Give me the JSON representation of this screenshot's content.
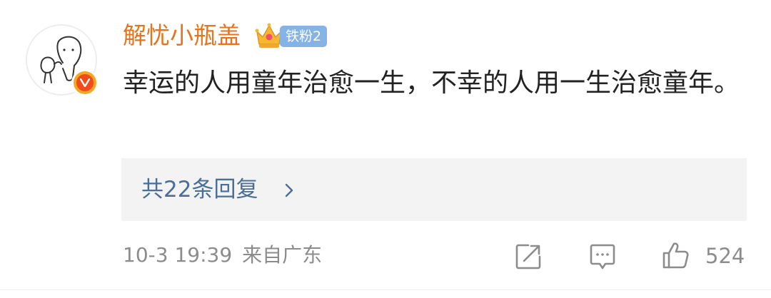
{
  "comment": {
    "username": "解忧小瓶盖",
    "fan_badge": "铁粉2",
    "text": "幸运的人用童年治愈一生，不幸的人用一生治愈童年。",
    "replies_label": "共22条回复",
    "timestamp": "10-3 19:39",
    "location": "来自广东",
    "like_count": "524"
  },
  "colors": {
    "username": "#e8731b",
    "text": "#222222",
    "link": "#4a6e97",
    "meta": "#8c8c8c",
    "replies_background": "#f3f3f3",
    "fan_badge": "#86b3e6",
    "verify_badge": "#f24a1b"
  },
  "icons": {
    "avatar": "doodle-bear-avatar",
    "verify": "verified-v-badge-icon",
    "crown": "crown-icon",
    "chevron": "chevron-right-icon",
    "share": "share-icon",
    "comment": "comment-icon",
    "like": "thumbs-up-icon"
  }
}
